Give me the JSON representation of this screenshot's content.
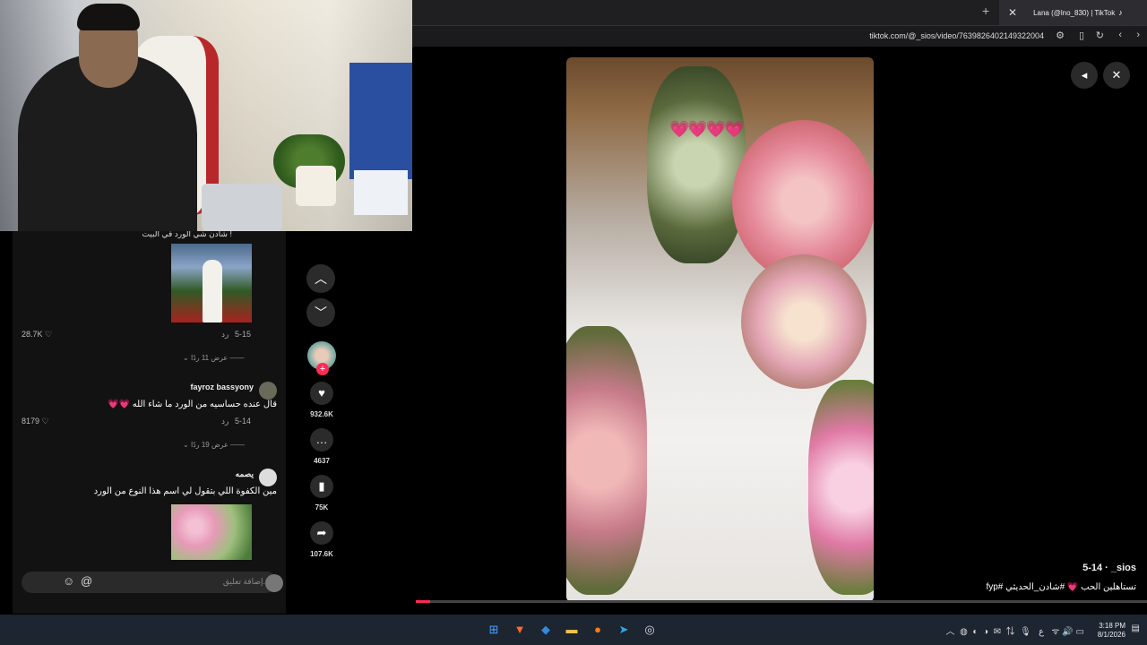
{
  "browser": {
    "tab_title": "Lana (@lno_830) | TikTok",
    "url": "tiktok.com/@_sios/video/7639826402149322004"
  },
  "comments": {
    "top_cut_text": "شادن شي الورد في البيت !",
    "items": [
      {
        "date": "5-15",
        "reply": "رد",
        "likes": "28.7K",
        "view_replies": "عرض 11 ردًا"
      },
      {
        "name": "fayroz bassyony",
        "text": "قال عنده حساسيه من الورد ما شاء الله 💗💗",
        "date": "5-14",
        "reply": "رد",
        "likes": "8179",
        "view_replies": "عرض 19 ردًا"
      },
      {
        "name": "يصمه",
        "text": "مين الكفوة اللي بتقول لي اسم هذا النوع من الورد"
      }
    ],
    "input_placeholder": "إضافة تعليق..."
  },
  "actions": {
    "likes": "932.6K",
    "comments": "4637",
    "saves": "75K",
    "shares": "107.6K"
  },
  "video": {
    "hearts": "💗💗💗💗",
    "user": "5-14 · _sios",
    "caption": "تستاهلين الحب 💗 #شادن_الحديثي #fyp",
    "progress": 0.02
  },
  "taskbar": {
    "time": "3:18 PM",
    "date": "8/1/2026",
    "lang": "ع"
  },
  "colors": {
    "accent": "#fe2c55"
  }
}
